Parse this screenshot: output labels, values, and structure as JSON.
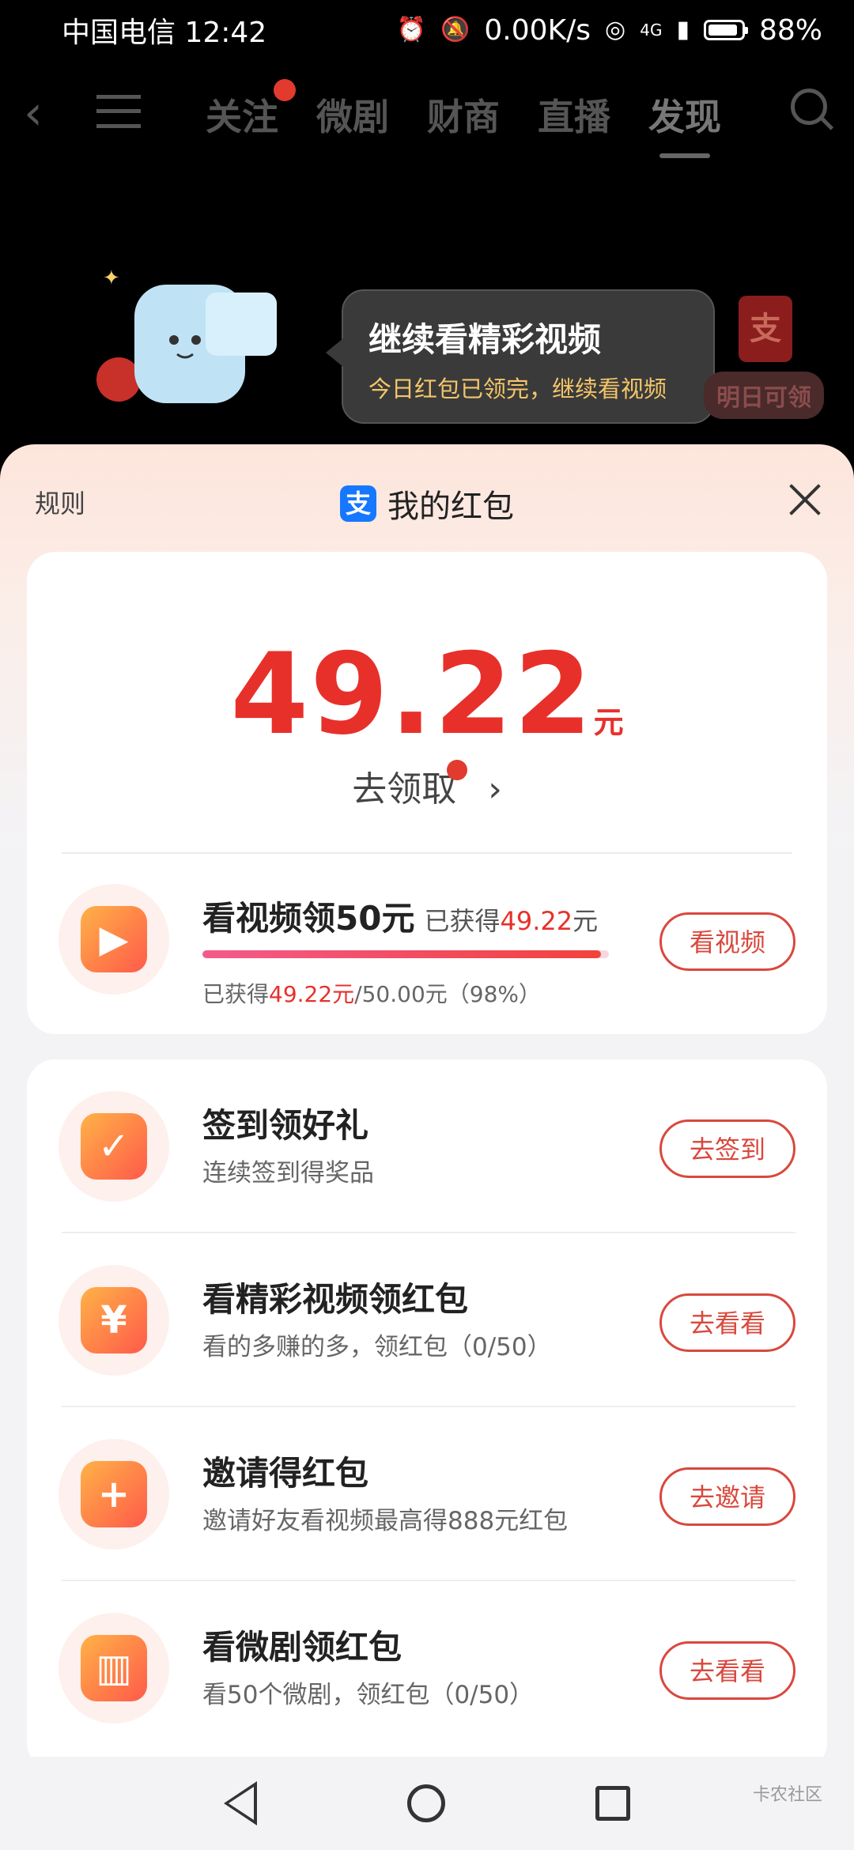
{
  "status": {
    "carrier": "中国电信",
    "time": "12:42",
    "speed": "0.00K/s",
    "network": "4G",
    "battery": "88%"
  },
  "top_nav": {
    "tabs": [
      "关注",
      "微剧",
      "财商",
      "直播",
      "发现"
    ],
    "active_tab": "发现"
  },
  "bubble": {
    "title": "继续看精彩视频",
    "subtitle": "今日红包已领完，继续看视频"
  },
  "tomorrow_badge": "明日可领",
  "red_envelope_glyph": "支",
  "sheet": {
    "rules": "规则",
    "title": "我的红包",
    "alipay_glyph": "支"
  },
  "balance": {
    "amount": "49.22",
    "unit": "元",
    "claim": "去领取"
  },
  "watch_task": {
    "title": "看视频领50元",
    "earned_prefix": "已获得",
    "earned_value": "49.22",
    "earned_unit": "元",
    "progress_prefix": "已获得",
    "progress_value": "49.22元",
    "progress_total": "/50.00元（98%）",
    "progress_fraction": 0.98,
    "button": "看视频"
  },
  "tasks": [
    {
      "title": "签到领好礼",
      "sub": "连续签到得奖品",
      "button": "去签到",
      "icon": "calendar-check-icon"
    },
    {
      "title": "看精彩视频领红包",
      "sub": "看的多赚的多，领红包（0/50）",
      "button": "去看看",
      "icon": "yen-envelope-icon"
    },
    {
      "title": "邀请得红包",
      "sub": "邀请好友看视频最高得888元红包",
      "button": "去邀请",
      "icon": "add-user-icon"
    },
    {
      "title": "看微剧领红包",
      "sub": "看50个微剧，领红包（0/50）",
      "button": "去看看",
      "icon": "tv-icon"
    }
  ],
  "watermark": "卡农社区"
}
